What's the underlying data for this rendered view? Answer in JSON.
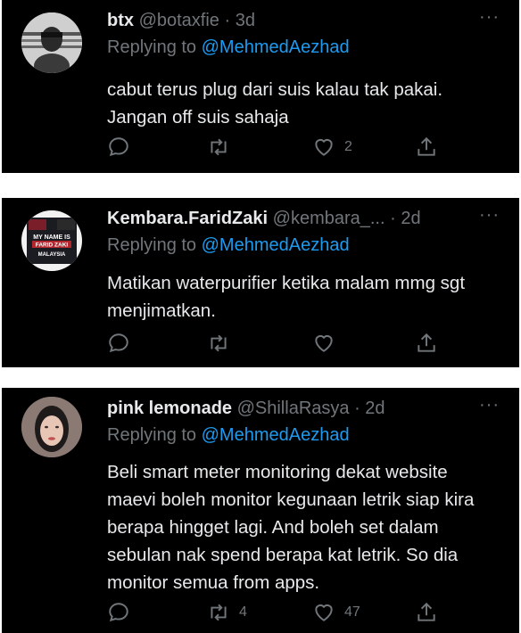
{
  "tweets": [
    {
      "name": "btx",
      "handle": "@botaxfie",
      "time": "· 3d",
      "reply_prefix": "Replying to ",
      "reply_to": "@MehmedAezhad",
      "text": "cabut terus plug dari suis kalau tak pakai. Jangan off suis sahaja",
      "replies": "",
      "retweets": "",
      "likes": "2"
    },
    {
      "name": "Kembara.FaridZaki",
      "handle": "@kembara_...",
      "time": "· 2d",
      "reply_prefix": "Replying to ",
      "reply_to": "@MehmedAezhad",
      "text": "Matikan waterpurifier ketika malam mmg sgt menjimatkan.",
      "avatar_text": [
        "MY NAME IS",
        "FARID ZAKI",
        "MALAYSIA"
      ],
      "replies": "",
      "retweets": "",
      "likes": ""
    },
    {
      "name": "pink lemonade",
      "handle": "@ShillaRasya",
      "time": "· 2d",
      "reply_prefix": "Replying to ",
      "reply_to": "@MehmedAezhad",
      "text": "Beli smart meter monitoring dekat website maevi boleh monitor kegunaan letrik siap kira berapa hingget lagi. And boleh set dalam sebulan nak spend berapa kat letrik. So dia monitor semua from apps.",
      "replies": "",
      "retweets": "4",
      "likes": "47"
    }
  ],
  "icons": {
    "more": "more-icon",
    "reply": "reply-icon",
    "retweet": "retweet-icon",
    "like": "like-icon",
    "share": "share-icon"
  },
  "colors": {
    "background": "#000000",
    "text": "#e7e9ea",
    "muted": "#71767b",
    "link": "#1d9bf0"
  }
}
